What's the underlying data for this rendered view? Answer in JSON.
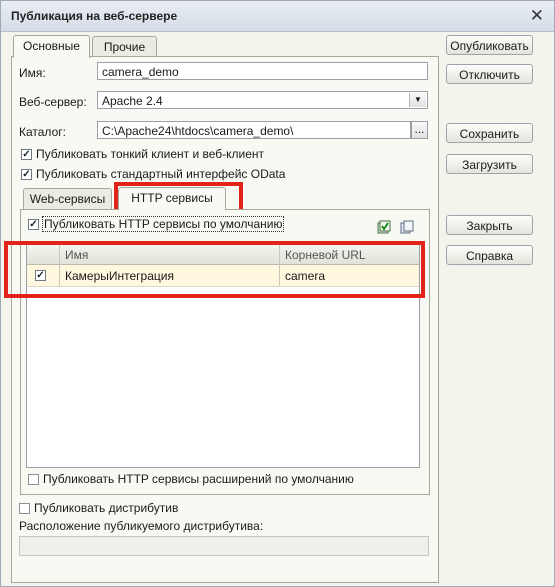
{
  "window": {
    "title": "Публикация на веб-сервере"
  },
  "tabs": [
    {
      "label": "Основные"
    },
    {
      "label": "Прочие"
    }
  ],
  "form": {
    "name_label": "Имя:",
    "name_value": "camera_demo",
    "server_label": "Веб-сервер:",
    "server_value": "Apache 2.4",
    "catalog_label": "Каталог:",
    "catalog_value": "C:\\Apache24\\htdocs\\camera_demo\\",
    "browse_label": "...",
    "publish_thin_client": "Публиковать тонкий клиент и веб-клиент",
    "publish_odata": "Публиковать стандартный интерфейс OData"
  },
  "subtabs": [
    {
      "label": "Web-сервисы"
    },
    {
      "label": "HTTP сервисы"
    }
  ],
  "http": {
    "publish_default_label": "Публиковать HTTP сервисы по умолчанию",
    "columns": [
      "Имя",
      "Корневой URL"
    ],
    "rows": [
      {
        "checked": true,
        "name": "КамерыИнтеграция",
        "url": "camera"
      }
    ],
    "publish_extensions_label": "Публиковать HTTP сервисы расширений по умолчанию"
  },
  "distr": {
    "publish_label": "Публиковать дистрибутив",
    "location_label": "Расположение публикуемого дистрибутива:",
    "location_value": ""
  },
  "buttons": {
    "publish": "Опубликовать",
    "disable": "Отключить",
    "save": "Сохранить",
    "load": "Загрузить",
    "close": "Закрыть",
    "help": "Справка"
  },
  "colors": {
    "highlight": "#e2231a",
    "row_bg": "#fff8df",
    "panel_bg": "#f4f3ec"
  },
  "icons": {
    "close": "close-icon",
    "check_all": "check-all-icon",
    "copy": "copy-icon",
    "dropdown": "chevron-down-icon"
  }
}
